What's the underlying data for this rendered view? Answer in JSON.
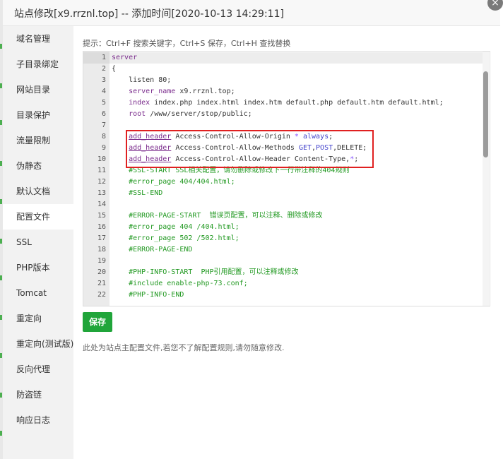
{
  "dialog": {
    "title": "站点修改[x9.rrznl.top] -- 添加时间[2020-10-13 14:29:11]",
    "close_icon": "×"
  },
  "sidebar": {
    "items": [
      {
        "label": "域名管理"
      },
      {
        "label": "子目录绑定"
      },
      {
        "label": "网站目录"
      },
      {
        "label": "目录保护"
      },
      {
        "label": "流量限制"
      },
      {
        "label": "伪静态"
      },
      {
        "label": "默认文档"
      },
      {
        "label": "配置文件",
        "active": true
      },
      {
        "label": "SSL"
      },
      {
        "label": "PHP版本"
      },
      {
        "label": "Tomcat"
      },
      {
        "label": "重定向"
      },
      {
        "label": "重定向(测试版)"
      },
      {
        "label": "反向代理"
      },
      {
        "label": "防盗链"
      },
      {
        "label": "响应日志"
      }
    ]
  },
  "editor": {
    "hint": "提示：Ctrl+F 搜索关键字，Ctrl+S 保存，Ctrl+H 查找替换",
    "line_numbers": [
      "1",
      "2",
      "3",
      "4",
      "5",
      "6",
      "7",
      "8",
      "9",
      "10",
      "11",
      "12",
      "13",
      "14",
      "15",
      "16",
      "17",
      "18",
      "19",
      "20",
      "21",
      "22"
    ],
    "lines": [
      [
        {
          "t": "server",
          "c": "kw"
        }
      ],
      [
        {
          "t": "{"
        }
      ],
      [
        {
          "t": "    listen 80;"
        }
      ],
      [
        {
          "t": "    "
        },
        {
          "t": "server_name",
          "c": "kw"
        },
        {
          "t": " x9.rrznl.top;"
        }
      ],
      [
        {
          "t": "    "
        },
        {
          "t": "index",
          "c": "kw"
        },
        {
          "t": " index.php index.html index.htm default.php default.htm default.html;"
        }
      ],
      [
        {
          "t": "    "
        },
        {
          "t": "root",
          "c": "kw"
        },
        {
          "t": " /www/server/stop/public;"
        }
      ],
      [
        {
          "t": ""
        }
      ],
      [
        {
          "t": "    "
        },
        {
          "t": "add_header",
          "c": "hd"
        },
        {
          "t": " Access-Control-Allow-Origin "
        },
        {
          "t": "*",
          "c": "op"
        },
        {
          "t": " "
        },
        {
          "t": "always",
          "c": "vl"
        },
        {
          "t": ";"
        }
      ],
      [
        {
          "t": "    "
        },
        {
          "t": "add_header",
          "c": "hd"
        },
        {
          "t": " Access-Control-Allow-Methods "
        },
        {
          "t": "GET",
          "c": "vl"
        },
        {
          "t": ","
        },
        {
          "t": "POST",
          "c": "vl"
        },
        {
          "t": ",DELETE;"
        }
      ],
      [
        {
          "t": "    "
        },
        {
          "t": "add_header",
          "c": "hd"
        },
        {
          "t": " Access-Control-Allow-Header Content-Type,"
        },
        {
          "t": "*",
          "c": "op"
        },
        {
          "t": ";"
        }
      ],
      [
        {
          "t": "    "
        },
        {
          "t": "#SSL-START SSL相关配置，请勿删除或修改下一行带注释的404规则",
          "c": "cm"
        }
      ],
      [
        {
          "t": "    "
        },
        {
          "t": "#error_page 404/404.html;",
          "c": "cm"
        }
      ],
      [
        {
          "t": "    "
        },
        {
          "t": "#SSL-END",
          "c": "cm"
        }
      ],
      [
        {
          "t": ""
        }
      ],
      [
        {
          "t": "    "
        },
        {
          "t": "#ERROR-PAGE-START  错误页配置，可以注释、删除或修改",
          "c": "cm"
        }
      ],
      [
        {
          "t": "    "
        },
        {
          "t": "#error_page 404 /404.html;",
          "c": "cm"
        }
      ],
      [
        {
          "t": "    "
        },
        {
          "t": "#error_page 502 /502.html;",
          "c": "cm"
        }
      ],
      [
        {
          "t": "    "
        },
        {
          "t": "#ERROR-PAGE-END",
          "c": "cm"
        }
      ],
      [
        {
          "t": ""
        }
      ],
      [
        {
          "t": "    "
        },
        {
          "t": "#PHP-INFO-START  PHP引用配置，可以注释或修改",
          "c": "cm"
        }
      ],
      [
        {
          "t": "    "
        },
        {
          "t": "#include enable-php-73.conf;",
          "c": "cm"
        }
      ],
      [
        {
          "t": "    "
        },
        {
          "t": "#PHP-INFO-END",
          "c": "cm"
        }
      ]
    ]
  },
  "actions": {
    "save_label": "保存"
  },
  "footer": {
    "note": "此处为站点主配置文件,若您不了解配置规则,请勿随意修改."
  },
  "colors": {
    "accent_green": "#20a53a",
    "highlight_red": "#e02020"
  }
}
